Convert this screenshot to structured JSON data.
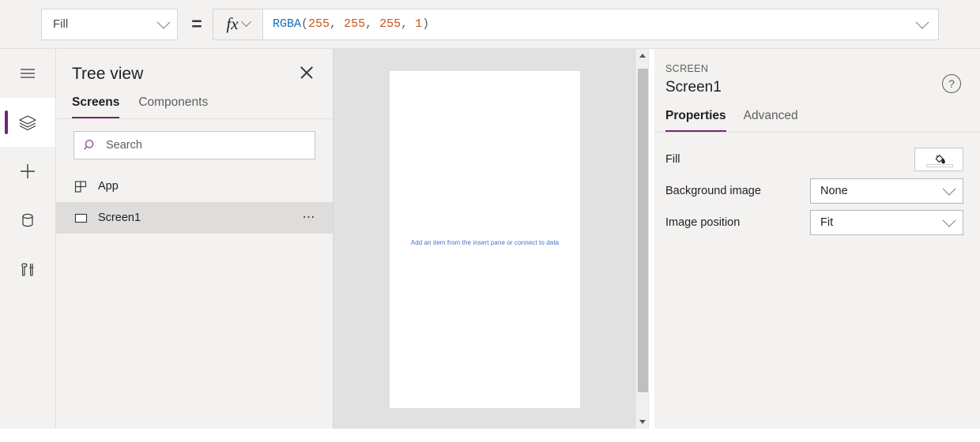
{
  "formula_bar": {
    "property_selector": {
      "value": "Fill",
      "icon": "chevron-down-icon"
    },
    "equals": "=",
    "fx_label": "fx",
    "formula": {
      "full_text": "RGBA(255, 255, 255, 1)",
      "tokens": [
        {
          "text": "RGBA",
          "type": "function"
        },
        {
          "text": "(",
          "type": "punctuation"
        },
        {
          "text": "255",
          "type": "number"
        },
        {
          "text": ", ",
          "type": "punctuation"
        },
        {
          "text": "255",
          "type": "number"
        },
        {
          "text": ", ",
          "type": "punctuation"
        },
        {
          "text": "255",
          "type": "number"
        },
        {
          "text": ", ",
          "type": "punctuation"
        },
        {
          "text": "1",
          "type": "number"
        },
        {
          "text": ")",
          "type": "punctuation"
        }
      ]
    },
    "expand_icon": "chevron-down-icon"
  },
  "left_rail": {
    "items": [
      {
        "icon": "hamburger-menu-icon",
        "name": "menu",
        "active": false
      },
      {
        "icon": "layers-icon",
        "name": "tree-view",
        "active": true
      },
      {
        "icon": "plus-icon",
        "name": "insert",
        "active": false
      },
      {
        "icon": "database-icon",
        "name": "data",
        "active": false
      },
      {
        "icon": "tools-icon",
        "name": "advanced-tools",
        "active": false
      }
    ]
  },
  "tree_view": {
    "title": "Tree view",
    "close_icon": "close-icon",
    "tabs": [
      {
        "label": "Screens",
        "selected": true
      },
      {
        "label": "Components",
        "selected": false
      }
    ],
    "search": {
      "placeholder": "Search",
      "value": "",
      "icon": "search-icon"
    },
    "items": [
      {
        "label": "App",
        "icon": "app-grid-icon",
        "selected": false,
        "has_menu": false
      },
      {
        "label": "Screen1",
        "icon": "screen-rect-icon",
        "selected": true,
        "has_menu": true,
        "menu_icon": "ellipsis-icon"
      }
    ]
  },
  "canvas": {
    "hint_text": "Add an item from the insert pane or connect to data",
    "hint_color": "#4472c4",
    "screen_fill": "#ffffff",
    "background": "#e1e1e1",
    "scrollbar": {
      "up_icon": "triangle-up-icon",
      "down_icon": "triangle-down-icon",
      "thumb": "scrollbar-thumb"
    }
  },
  "properties_panel": {
    "kicker": "SCREEN",
    "name": "Screen1",
    "help_icon": "question-mark-icon",
    "help_glyph": "?",
    "tabs": [
      {
        "label": "Properties",
        "selected": true
      },
      {
        "label": "Advanced",
        "selected": false
      }
    ],
    "rows": [
      {
        "label": "Fill",
        "type": "color",
        "value": "#ffffff",
        "icon": "paint-bucket-icon"
      },
      {
        "label": "Background image",
        "type": "dropdown",
        "value": "None",
        "icon": "chevron-down-icon"
      },
      {
        "label": "Image position",
        "type": "dropdown",
        "value": "Fit",
        "icon": "chevron-down-icon"
      }
    ]
  },
  "theme": {
    "accent": "#742774",
    "panel_bg": "#f3f2f1",
    "border": "#e1dfdd"
  }
}
